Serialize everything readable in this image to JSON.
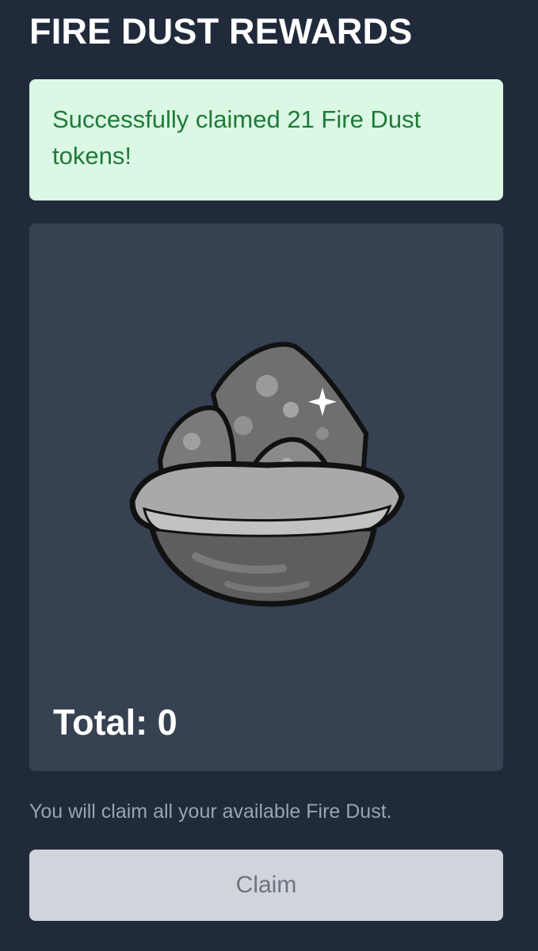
{
  "page": {
    "title": "FIRE DUST REWARDS"
  },
  "alert": {
    "message": "Successfully claimed 21 Fire Dust tokens!"
  },
  "reward": {
    "image_icon": "fire-dust-rock-pile",
    "total_text": "Total: 0"
  },
  "claim": {
    "note": "You will claim all your available Fire Dust.",
    "button_label": "Claim",
    "enabled": false
  },
  "colors": {
    "background": "#212a3a",
    "card": "#364152",
    "alert_bg": "#dbf8e4",
    "alert_text": "#1f7a3a",
    "button_bg": "#d1d5db",
    "button_text": "#6b7280"
  }
}
